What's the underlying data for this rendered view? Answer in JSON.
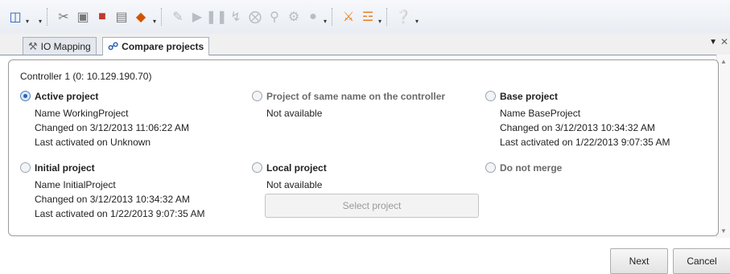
{
  "tabs": [
    {
      "label": "IO Mapping",
      "icon": "io-mapping-icon"
    },
    {
      "label": "Compare projects",
      "icon": "compare-projects-icon"
    }
  ],
  "panel": {
    "controller_label": "Controller 1 (0: 10.129.190.70)",
    "active_project": {
      "title": "Active project",
      "selected": true,
      "name": "Name  WorkingProject",
      "changed": "Changed on  3/12/2013 11:06:22 AM",
      "activated": "Last activated on  Unknown"
    },
    "same_name_project": {
      "title": "Project of same name on the controller",
      "status": "Not available"
    },
    "base_project": {
      "title": "Base project",
      "name": "Name  BaseProject",
      "changed": "Changed on  3/12/2013 10:34:32 AM",
      "activated": "Last activated on  1/22/2013 9:07:35 AM"
    },
    "initial_project": {
      "title": "Initial project",
      "name": "Name  InitialProject",
      "changed": "Changed on  3/12/2013 10:34:32 AM",
      "activated": "Last activated on  1/22/2013 9:07:35 AM"
    },
    "local_project": {
      "title": "Local project",
      "status": "Not available",
      "select_button": "Select project"
    },
    "do_not_merge": {
      "title": "Do not merge"
    }
  },
  "footer": {
    "next": "Next",
    "cancel": "Cancel"
  },
  "colors": {
    "accent": "#2a62b8",
    "border": "#9a9a9a"
  }
}
